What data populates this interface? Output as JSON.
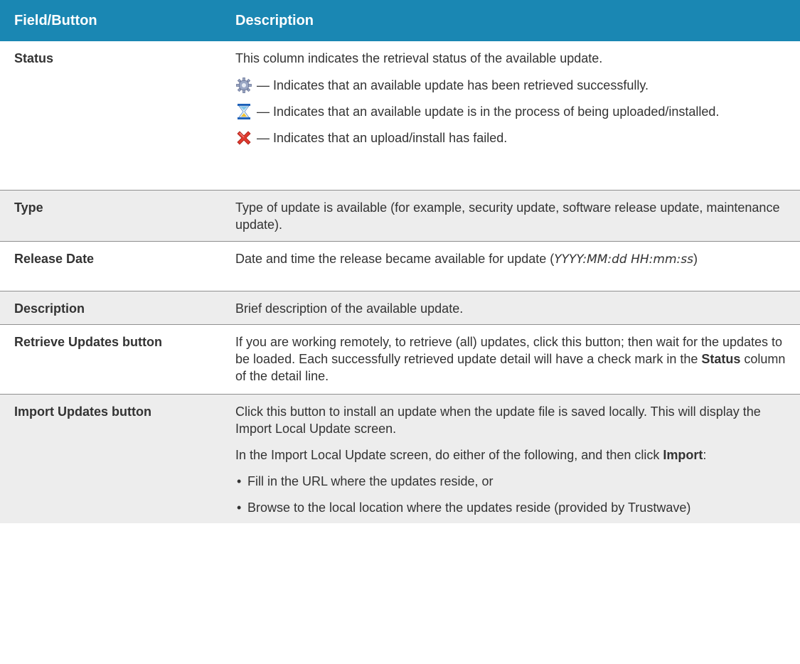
{
  "header": {
    "col1": "Field/Button",
    "col2": "Description"
  },
  "rows": [
    {
      "field": "Status",
      "desc": "This column indicates the retrieval status of the available update.",
      "status_items": [
        {
          "icon": "gear-icon",
          "text": "— Indicates that an available update has been retrieved successfully."
        },
        {
          "icon": "hourglass-icon",
          "text": "— Indicates that an available update is in the process of being uploaded/installed."
        },
        {
          "icon": "red-x-icon",
          "text": "— Indicates that an upload/install has failed."
        }
      ]
    },
    {
      "field": "Type",
      "desc": "Type of update is available (for example, security update, software release update, maintenance update)."
    },
    {
      "field": "Release Date",
      "desc_pre": "Date and time the release became available for update (",
      "desc_format": "YYYY:MM:dd HH:mm:ss",
      "desc_post": ")"
    },
    {
      "field": "Description",
      "desc": "Brief description of the available update."
    },
    {
      "field": "Retrieve Updates button",
      "desc_pre": "If you are working remotely, to retrieve (all) updates, click this button; then wait for the updates to be loaded. Each successfully retrieved update detail will have a check mark in the ",
      "desc_bold": "Status",
      "desc_post": " column of the detail line."
    },
    {
      "field": "Import Updates button",
      "p1": "Click this button to install an update when the update file is saved locally. This will display the Import Local Update screen.",
      "p2_pre": "In the Import Local Update screen, do either of the following, and then click ",
      "p2_bold": "Import",
      "p2_post": ":",
      "bullet_char": "•",
      "bullets": [
        "Fill in the URL where the updates reside, or",
        "Browse to the local location where the updates reside (provided by Trustwave)"
      ]
    }
  ],
  "colors": {
    "header_bg": "#1a87b3",
    "alt_row_bg": "#ededed",
    "text": "#333333"
  }
}
